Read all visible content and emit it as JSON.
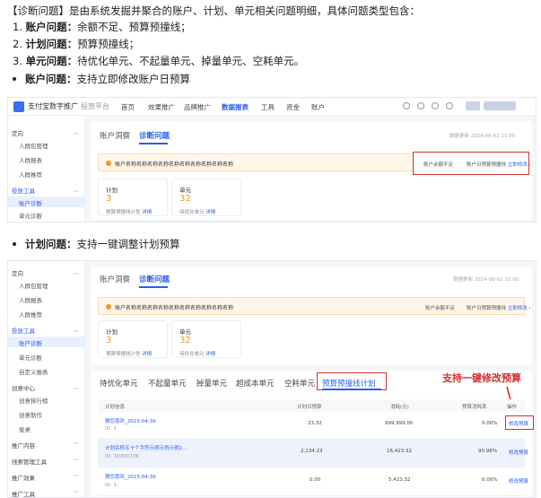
{
  "intro": {
    "bracket": "【诊断问题】",
    "text": "是由系统发掘并聚合的账户、计划、单元相关问题明细，具体问题类型包含："
  },
  "list": [
    {
      "num": "1.",
      "label": "账户问题：",
      "text": "余额不足、预算预撞线；"
    },
    {
      "num": "2.",
      "label": "计划问题：",
      "text": "预算预撞线；"
    },
    {
      "num": "3.",
      "label": "单元问题：",
      "text": "待优化单元、不起量单元、掉量单元、空耗单元。"
    }
  ],
  "bullets": [
    {
      "label": "账户问题：",
      "text": "支持立即修改账户日预算"
    },
    {
      "label": "计划问题：",
      "text": "支持一键调整计划预算"
    }
  ],
  "shot1": {
    "brand": "支付宝数字推广",
    "brand_sub": "投放平台",
    "nav": [
      "首页",
      "效果推广",
      "品牌推广",
      "数据报表",
      "工具",
      "资金",
      "账户"
    ],
    "sidebar": {
      "group1": "定向",
      "items1": [
        "人群包管理",
        "人群报表",
        "人群推荐"
      ],
      "group2": "投放工具",
      "items2": [
        "账户诊断",
        "单元诊断"
      ]
    },
    "tabs": [
      "账户洞察",
      "诊断问题"
    ],
    "updated": "数据更新 2024-06-02 11:00",
    "alert_text": "账户名称名称名称名称名称名称名称名称名称名称",
    "alert_r1": "账户余额不足",
    "alert_r2": "账户日预算预撞线",
    "alert_link": "立即修改",
    "cards": [
      {
        "title": "计划",
        "num": "3",
        "desc": "预算预撞线计划",
        "link": "详情"
      },
      {
        "title": "单元",
        "num": "32",
        "desc": "待优化单元",
        "link": "详情"
      }
    ]
  },
  "shot2": {
    "sidebar": {
      "group1": "定向",
      "items1": [
        "人群包管理",
        "人群报表",
        "人群推荐"
      ],
      "group2": "投放工具",
      "items2": [
        "账户诊断",
        "单元诊断",
        "自定义报表"
      ],
      "group3": "创意中心",
      "items3": [
        "创意排行榜",
        "创意制作",
        "星桌"
      ],
      "more": [
        "推广内容",
        "线索管理工具",
        "推广效果",
        "推广工具"
      ]
    },
    "tabs": [
      "账户洞察",
      "诊断问题"
    ],
    "updated": "数据更新 2024-06-02 10:00",
    "alert_text": "账户名称名称名称名称名称名称名称名称名称名称",
    "alert_r1": "账户余额不足",
    "alert_r2": "账户日预算预撞线",
    "alert_link": "立即修改",
    "cards": [
      {
        "title": "计划",
        "num": "3",
        "desc": "预算预撞线计划",
        "link": "详情"
      },
      {
        "title": "单元",
        "num": "32",
        "desc": "待优化单元",
        "link": "详情"
      }
    ],
    "subtabs": [
      "待优化单元",
      "不起量单元",
      "掉量单元",
      "超成本单元",
      "空耗单元",
      "预算预撞线计划"
    ],
    "annotation": "支持一键修改预算",
    "columns": [
      "计划信息",
      "计划日预算",
      "消耗(元)",
      "预算消耗率",
      "操作"
    ],
    "rows": [
      {
        "name": "猜您喜欢_2023-04-39",
        "id": "ID: 1",
        "budget": "23.32",
        "cost": "999,999.00",
        "rate": "0.00%",
        "op": "修改预算"
      },
      {
        "name": "计划名称五十个字符示例示例示例2...",
        "id": "ID: 10300726",
        "budget": "2,134.23",
        "cost": "16,423.32",
        "rate": "90.98%",
        "op": "修改预算"
      },
      {
        "name": "猜您喜欢_2023-04-39",
        "id": "ID: 1",
        "budget": "0.00",
        "cost": "5,423.32",
        "rate": "0.00%",
        "op": "修改预算"
      }
    ]
  }
}
